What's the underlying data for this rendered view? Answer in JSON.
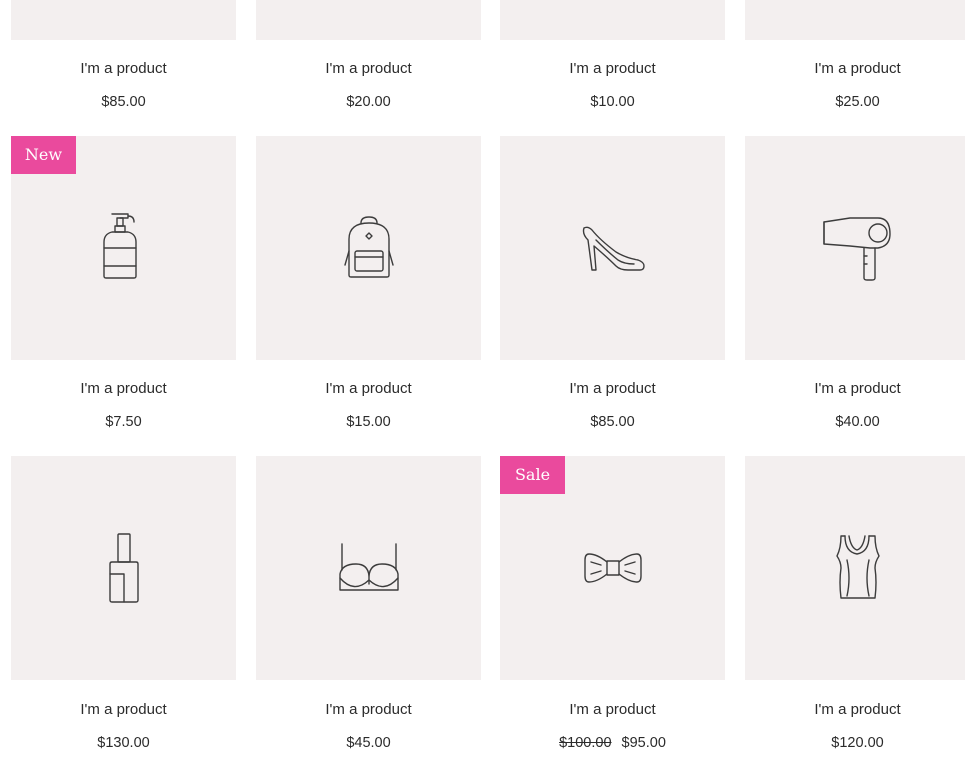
{
  "products": [
    {
      "name": "I'm a product",
      "price": "$85.00"
    },
    {
      "name": "I'm a product",
      "price": "$20.00"
    },
    {
      "name": "I'm a product",
      "price": "$10.00"
    },
    {
      "name": "I'm a product",
      "price": "$25.00"
    },
    {
      "name": "I'm a product",
      "price": "$7.50",
      "ribbon": "New",
      "icon": "soap-dispenser-icon"
    },
    {
      "name": "I'm a product",
      "price": "$15.00",
      "icon": "backpack-icon"
    },
    {
      "name": "I'm a product",
      "price": "$85.00",
      "icon": "high-heel-shoe-icon"
    },
    {
      "name": "I'm a product",
      "price": "$40.00",
      "icon": "hair-dryer-icon"
    },
    {
      "name": "I'm a product",
      "price": "$130.00",
      "icon": "nail-polish-icon"
    },
    {
      "name": "I'm a product",
      "price": "$45.00",
      "icon": "bra-icon"
    },
    {
      "name": "I'm a product",
      "old_price": "$100.00",
      "price": "$95.00",
      "ribbon": "Sale",
      "icon": "bow-tie-icon"
    },
    {
      "name": "I'm a product",
      "price": "$120.00",
      "icon": "tank-top-icon"
    }
  ],
  "colors": {
    "thumbnail_bg": "#f3efef",
    "ribbon_bg": "#ea4a9d",
    "text": "#2b2b2b"
  }
}
